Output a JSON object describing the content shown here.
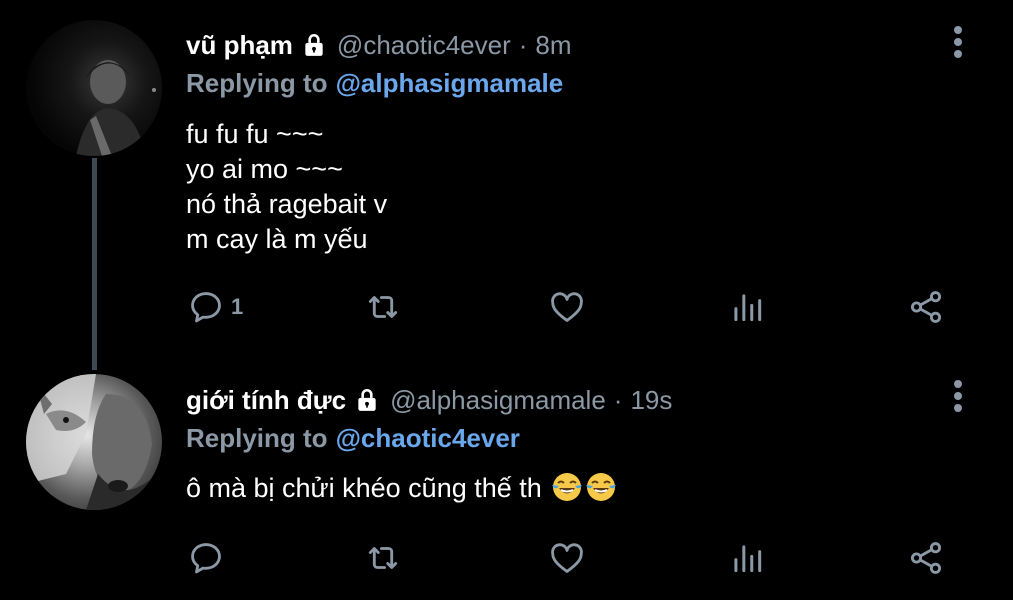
{
  "tweets": [
    {
      "name": "vũ phạm",
      "handle": "@chaotic4ever",
      "separator": "·",
      "time": "8m",
      "replying_label": "Replying to",
      "replying_to": "@alphasigmamale",
      "lines": [
        "fu fu fu ~~~",
        "yo ai mo ~~~",
        "nó thả ragebait v",
        "m cay là m yếu"
      ],
      "reply_count": "1",
      "avatar_icon": "profile-photo-dark",
      "locked": true
    },
    {
      "name": "giới tính đực",
      "handle": "@alphasigmamale",
      "separator": "·",
      "time": "19s",
      "replying_label": "Replying to",
      "replying_to": "@chaotic4ever",
      "text": "ô mà bị chửi khéo cũng thế th",
      "emoji": "face-with-tears-of-joy",
      "emoji_count": 2,
      "reply_count": "",
      "avatar_icon": "profile-photo-wolf",
      "locked": true
    }
  ],
  "icons": [
    "reply-icon",
    "retweet-icon",
    "like-icon",
    "analytics-icon",
    "share-icon",
    "more-icon",
    "lock-icon"
  ],
  "colors": {
    "background": "#000000",
    "primary_text": "#ffffff",
    "secondary_text": "#8b98a5",
    "mention": "#6aa7ec",
    "thread_line": "#3d4a54"
  }
}
